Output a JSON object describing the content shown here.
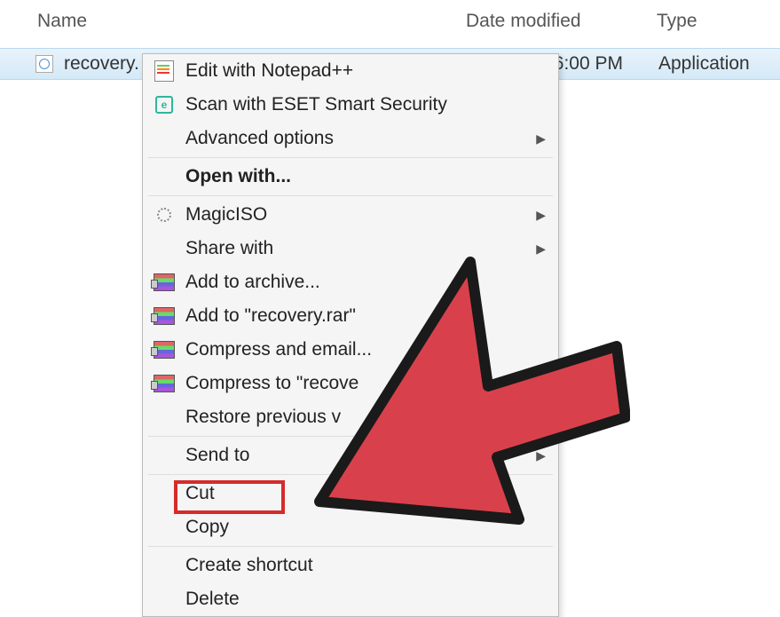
{
  "columns": {
    "name": "Name",
    "date": "Date modified",
    "type": "Type"
  },
  "file": {
    "name": "recovery.",
    "date": "6:00 PM",
    "type": "Application"
  },
  "menu": {
    "edit_notepad": "Edit with Notepad++",
    "scan_eset": "Scan with ESET Smart Security",
    "advanced_options": "Advanced options",
    "open_with": "Open with...",
    "magiciso": "MagicISO",
    "share_with": "Share with",
    "add_archive": "Add to archive...",
    "add_rar": "Add to \"recovery.rar\"",
    "compress_email": "Compress and email...",
    "compress_to": "Compress to \"recove",
    "restore_previous": "Restore previous v",
    "send_to": "Send to",
    "cut": "Cut",
    "copy": "Copy",
    "create_shortcut": "Create shortcut",
    "delete": "Delete"
  }
}
